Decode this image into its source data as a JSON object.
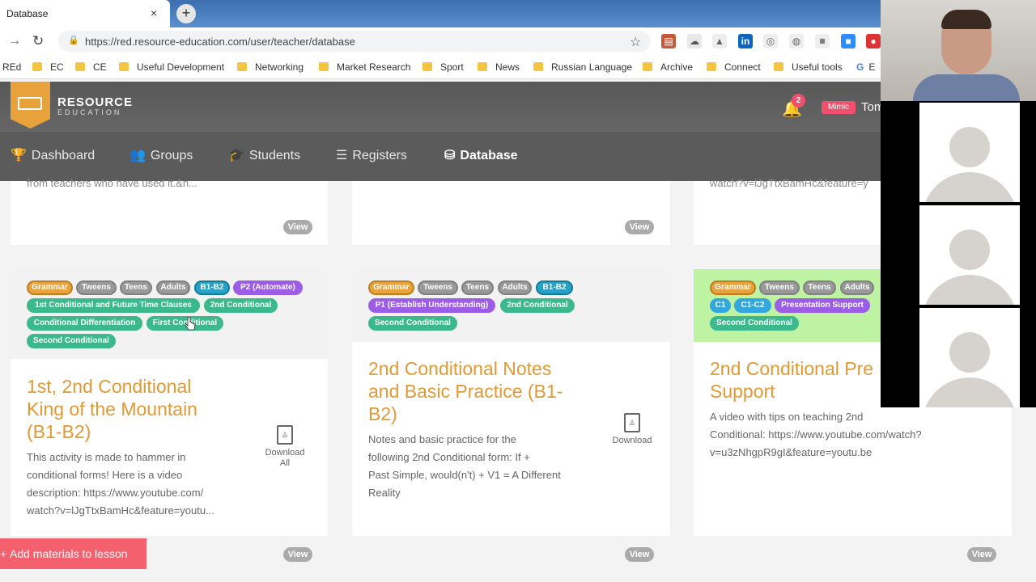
{
  "browser": {
    "tab_title": "Database",
    "tab_close": "×",
    "new_tab": "+",
    "url": "https://red.resource-education.com/user/teacher/database",
    "bookmarks": [
      "REd",
      "EC",
      "CE",
      "Useful Development",
      "Networking",
      "Market Research",
      "Sport",
      "News",
      "Russian Language",
      "Archive",
      "Connect",
      "Useful tools",
      "E"
    ]
  },
  "header": {
    "brand_line1": "RESOURCE",
    "brand_line2": "EDUCATION",
    "notification_count": "2",
    "mimic_label": "Mimic",
    "user_name": "Tom"
  },
  "nav": {
    "items": [
      {
        "label": "Dashboard",
        "icon": "trophy-icon"
      },
      {
        "label": "Groups",
        "icon": "users-icon"
      },
      {
        "label": "Students",
        "icon": "graduation-cap-icon"
      },
      {
        "label": "Registers",
        "icon": "list-icon"
      },
      {
        "label": "Database",
        "icon": "database-icon"
      }
    ],
    "active": "Database"
  },
  "top_cards": {
    "snippet_left": "from teachers who have used it.&n...",
    "snippet_right": "watch?v=lJgTtxBamHc&feature=y",
    "view_label": "View"
  },
  "cards": [
    {
      "tags": [
        "Grammar",
        "Tweens",
        "Teens",
        "Adults",
        "B1-B2",
        "P2 (Automate)",
        "1st Conditional and Future Time Clauses",
        "2nd Conditional",
        "Conditional Differentiation",
        "First Conditional",
        "Second Conditional"
      ],
      "title_lines": [
        "1st, 2nd Conditional",
        "King of the Mountain",
        "(B1-B2)"
      ],
      "desc_lines": [
        "This activity is made to hammer in",
        "conditional forms! Here is a video",
        "description: https://www.youtube.com/",
        "watch?v=lJgTtxBamHc&feature=youtu..."
      ],
      "download_line1": "Download",
      "download_line2": "All",
      "view_label": "View"
    },
    {
      "tags": [
        "Grammar",
        "Tweens",
        "Teens",
        "Adults",
        "B1-B2",
        "P1 (Establish Understanding)",
        "2nd Conditional",
        "Second Conditional"
      ],
      "title_lines": [
        "2nd Conditional Notes",
        "and Basic Practice (B1-",
        "B2)"
      ],
      "desc_lines": [
        "Notes and basic practice for the",
        "following 2nd Conditional form:  If +",
        "Past Simple, would(n't) + V1 = A Different",
        "Reality"
      ],
      "download_line1": "Download",
      "view_label": "View"
    },
    {
      "tags": [
        "Grammar",
        "Tweens",
        "Teens",
        "Adults",
        "C1",
        "C1-C2",
        "Presentation Support",
        "Second Conditional"
      ],
      "title_lines": [
        "2nd Conditional Pre",
        "Support"
      ],
      "desc_lines": [
        "A video with tips on teaching 2nd",
        "Conditional: https://www.youtube.com/watch?",
        "v=u3zNhgpR9gI&feature=youtu.be"
      ],
      "view_label": "View"
    }
  ],
  "actions": {
    "add_materials": "Add materials to lesson"
  },
  "colors": {
    "brand_orange": "#e6a33e",
    "title_orange": "#e09a35",
    "nav_bg": "#5b5b5b",
    "tag_green": "#3cb98c",
    "tag_purple": "#9b5de5",
    "add_button": "#f5606e"
  }
}
